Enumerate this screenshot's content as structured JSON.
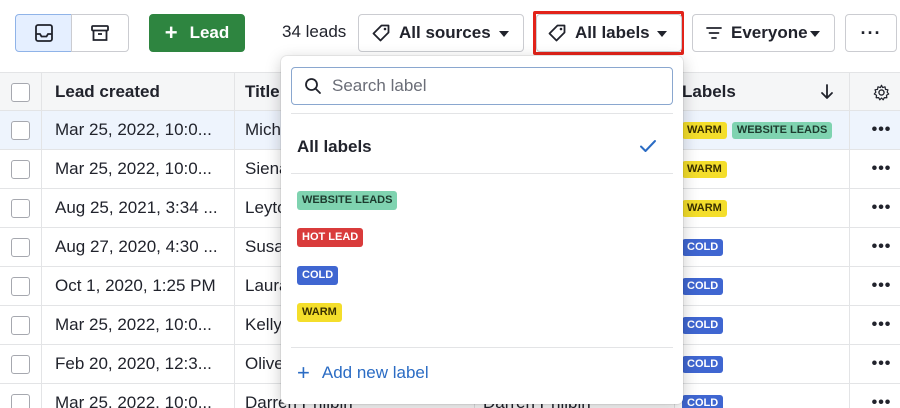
{
  "toolbar": {
    "lead_button_label": "Lead",
    "lead_count": "34 leads",
    "sources_label": "All sources",
    "labels_label": "All labels",
    "owner_label": "Everyone",
    "more_label": "···"
  },
  "table": {
    "headers": {
      "created": "Lead created",
      "title": "Title",
      "labels": "Labels"
    },
    "rows": [
      {
        "created": "Mar 25, 2022, 10:0...",
        "title": "Mich",
        "contact": "",
        "labels": [
          "WARM",
          "WEBSITE LEADS"
        ]
      },
      {
        "created": "Mar 25, 2022, 10:0...",
        "title": "Siena",
        "contact": "",
        "labels": [
          "WARM"
        ]
      },
      {
        "created": "Aug 25, 2021, 3:34 ...",
        "title": "Leyto",
        "contact": "",
        "labels": [
          "WARM"
        ]
      },
      {
        "created": "Aug 27, 2020, 4:30 ...",
        "title": "Susa",
        "contact": "",
        "labels": [
          "COLD"
        ]
      },
      {
        "created": "Oct 1, 2020, 1:25 PM",
        "title": "Laura",
        "contact": "",
        "labels": [
          "COLD"
        ]
      },
      {
        "created": "Mar 25, 2022, 10:0...",
        "title": "Kelly",
        "contact": "",
        "labels": [
          "COLD"
        ]
      },
      {
        "created": "Feb 20, 2020, 12:3...",
        "title": "Olive",
        "contact": "",
        "labels": [
          "COLD"
        ]
      },
      {
        "created": "Mar 25, 2022, 10:0...",
        "title": "Darren Philbin",
        "contact": "Darren Philbin",
        "labels": [
          "COLD"
        ]
      }
    ]
  },
  "dropdown": {
    "search_placeholder": "Search label",
    "all_labels": "All labels",
    "labels": [
      {
        "name": "WEBSITE LEADS",
        "bg": "#7fd3b0",
        "fg": "#1d3b2e"
      },
      {
        "name": "HOT LEAD",
        "bg": "#d93b3b",
        "fg": "#ffffff"
      },
      {
        "name": "COLD",
        "bg": "#3f66d1",
        "fg": "#ffffff"
      },
      {
        "name": "WARM",
        "bg": "#f4de2b",
        "fg": "#3a3000"
      }
    ],
    "add_label": "Add new label"
  },
  "colors": {
    "accent": "#2b6cc4",
    "lead_button": "#2e8540",
    "highlight": "#e2231a",
    "warm": "#f4de2b",
    "cold": "#3f66d1",
    "website_leads": "#7fd3b0",
    "hot_lead": "#d93b3b"
  },
  "icons": {
    "inbox": "inbox-icon",
    "archive": "archive-icon",
    "tag": "tag-icon",
    "filter": "filter-icon",
    "search": "search-icon",
    "check": "check-icon",
    "gear": "gear-icon",
    "sort": "sort-down-icon"
  }
}
